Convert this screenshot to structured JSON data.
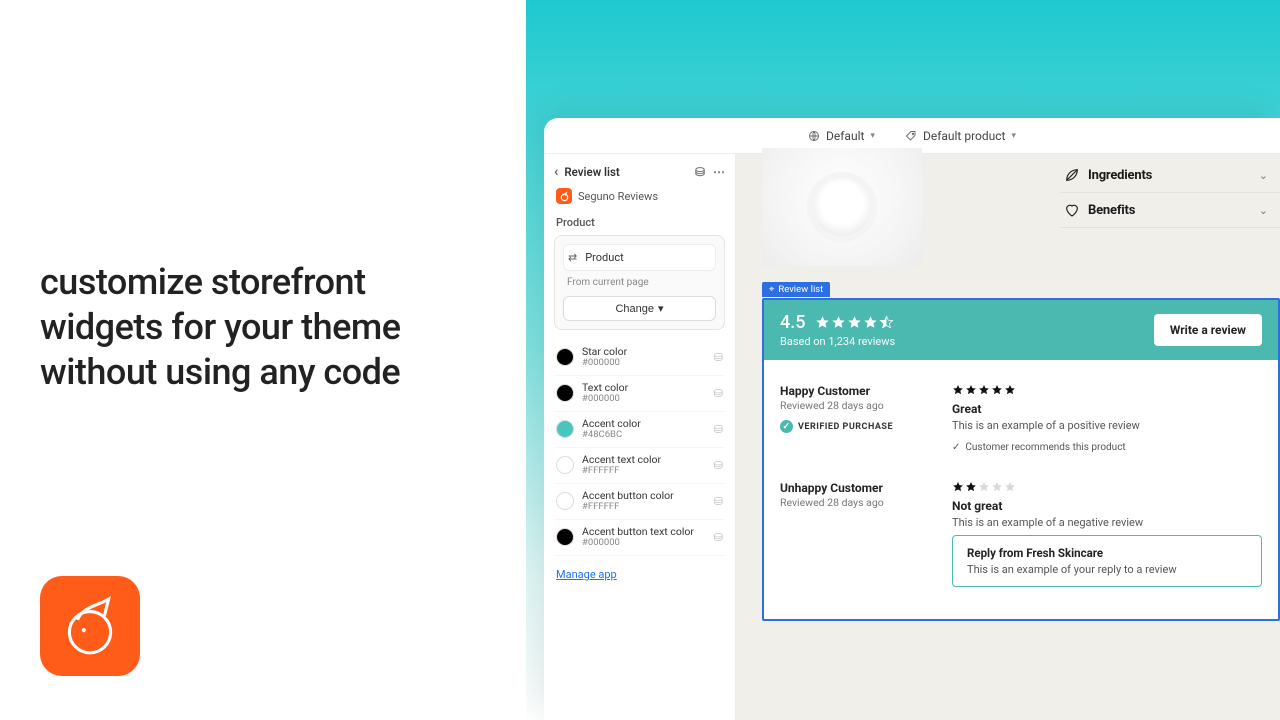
{
  "marketing": {
    "headline": "customize storefront widgets for your theme without using any code"
  },
  "topbar": {
    "view_label": "Default",
    "product_label": "Default product"
  },
  "panel": {
    "title": "Review list",
    "app_name": "Seguno Reviews",
    "product_section": "Product",
    "product_value": "Product",
    "product_helper": "From current page",
    "change_label": "Change",
    "manage_link": "Manage app",
    "colors": [
      {
        "name": "Star color",
        "hex": "#000000",
        "swatch": "#000000"
      },
      {
        "name": "Text color",
        "hex": "#000000",
        "swatch": "#000000"
      },
      {
        "name": "Accent color",
        "hex": "#48C6BC",
        "swatch": "#48C6BC"
      },
      {
        "name": "Accent text color",
        "hex": "#FFFFFF",
        "swatch": "#FFFFFF"
      },
      {
        "name": "Accent button color",
        "hex": "#FFFFFF",
        "swatch": "#FFFFFF"
      },
      {
        "name": "Accent button text color",
        "hex": "#000000",
        "swatch": "#000000"
      }
    ]
  },
  "storefront": {
    "accordion": {
      "ingredients": "Ingredients",
      "benefits": "Benefits"
    },
    "widget_tag": "Review list",
    "summary": {
      "rating": "4.5",
      "based_on": "Based on 1,234 reviews",
      "cta": "Write a review"
    },
    "reviews": [
      {
        "name": "Happy Customer",
        "time": "Reviewed 28 days ago",
        "verified": "VERIFIED PURCHASE",
        "stars": 5,
        "title": "Great",
        "body": "This is an example of a positive review",
        "recommend": "Customer recommends this product"
      },
      {
        "name": "Unhappy Customer",
        "time": "Reviewed 28 days ago",
        "stars": 2,
        "title": "Not great",
        "body": "This is an example of a negative review",
        "reply_title": "Reply from Fresh Skincare",
        "reply_body": "This is an example of your reply to a review"
      }
    ]
  }
}
